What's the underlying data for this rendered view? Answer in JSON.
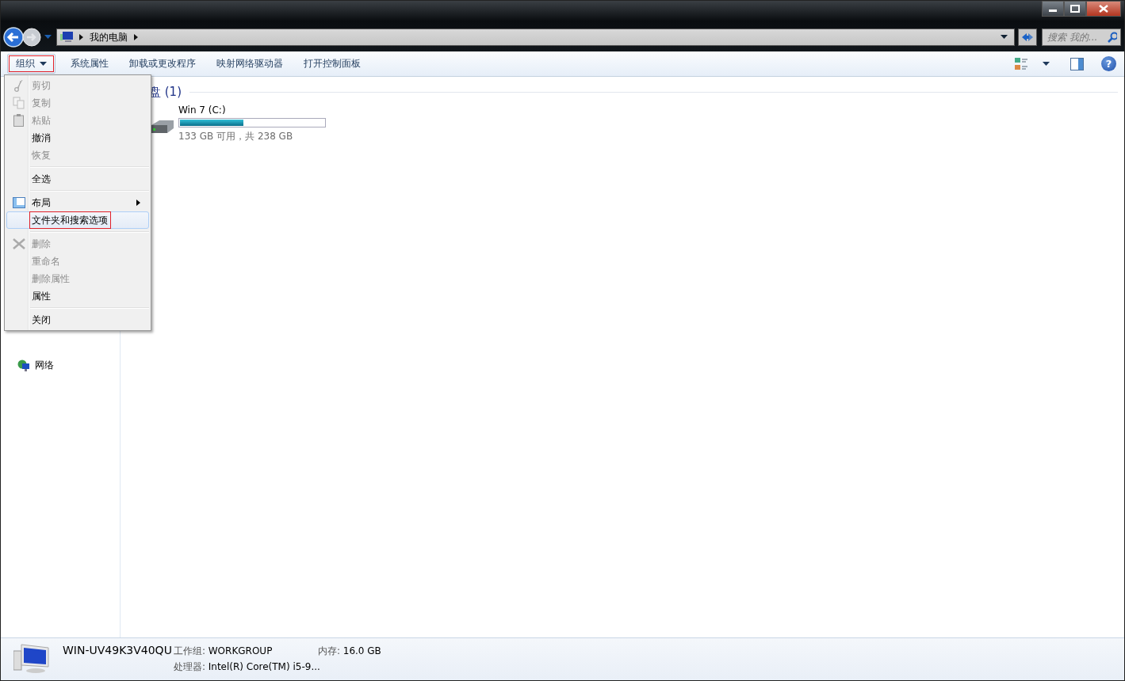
{
  "address": {
    "crumbs": [
      "我的电脑"
    ]
  },
  "search": {
    "placeholder": "搜索 我的..."
  },
  "help_button": "?",
  "toolbar": {
    "buttons": [
      {
        "label": "组织",
        "dropdown": true,
        "annotated": true
      },
      {
        "label": "系统属性",
        "dropdown": false,
        "annotated": false
      },
      {
        "label": "卸载或更改程序",
        "dropdown": false,
        "annotated": false
      },
      {
        "label": "映射网络驱动器",
        "dropdown": false,
        "annotated": false
      },
      {
        "label": "打开控制面板",
        "dropdown": false,
        "annotated": false
      }
    ]
  },
  "menu": {
    "items": [
      {
        "kind": "item",
        "label": "剪切",
        "disabled": true,
        "selected": false,
        "submenu": false,
        "annotated": false
      },
      {
        "kind": "item",
        "label": "复制",
        "disabled": true,
        "selected": false,
        "submenu": false,
        "annotated": false
      },
      {
        "kind": "item",
        "label": "粘贴",
        "disabled": true,
        "selected": false,
        "submenu": false,
        "annotated": false
      },
      {
        "kind": "item",
        "label": "撤消",
        "disabled": false,
        "selected": false,
        "submenu": false,
        "annotated": false
      },
      {
        "kind": "item",
        "label": "恢复",
        "disabled": true,
        "selected": false,
        "submenu": false,
        "annotated": false
      },
      {
        "kind": "separator"
      },
      {
        "kind": "item",
        "label": "全选",
        "disabled": false,
        "selected": false,
        "submenu": false,
        "annotated": false
      },
      {
        "kind": "separator"
      },
      {
        "kind": "item",
        "label": "布局",
        "disabled": false,
        "selected": false,
        "submenu": true,
        "annotated": false
      },
      {
        "kind": "item",
        "label": "文件夹和搜索选项",
        "disabled": false,
        "selected": true,
        "submenu": false,
        "annotated": true
      },
      {
        "kind": "separator"
      },
      {
        "kind": "item",
        "label": "删除",
        "disabled": true,
        "selected": false,
        "submenu": false,
        "annotated": false
      },
      {
        "kind": "item",
        "label": "重命名",
        "disabled": true,
        "selected": false,
        "submenu": false,
        "annotated": false
      },
      {
        "kind": "item",
        "label": "删除属性",
        "disabled": true,
        "selected": false,
        "submenu": false,
        "annotated": false
      },
      {
        "kind": "item",
        "label": "属性",
        "disabled": false,
        "selected": false,
        "submenu": false,
        "annotated": false
      },
      {
        "kind": "separator"
      },
      {
        "kind": "item",
        "label": "关闭",
        "disabled": false,
        "selected": false,
        "submenu": false,
        "annotated": false
      }
    ]
  },
  "sidebar": {
    "items": [
      {
        "label": "网络"
      }
    ]
  },
  "content": {
    "group_title": "盘 (1)",
    "drives": [
      {
        "name": "Win 7 (C:)",
        "level": 0.44,
        "info": "133 GB 可用，共 238 GB"
      }
    ]
  },
  "status_bar": {
    "computer_name": "WIN-UV49K3V40QU",
    "fields": [
      {
        "label": "工作组:",
        "value": "WORKGROUP"
      },
      {
        "label": "内存:",
        "value": "16.0 GB"
      },
      {
        "label": "处理器:",
        "value": "Intel(R) Core(TM) i5-9..."
      }
    ]
  }
}
